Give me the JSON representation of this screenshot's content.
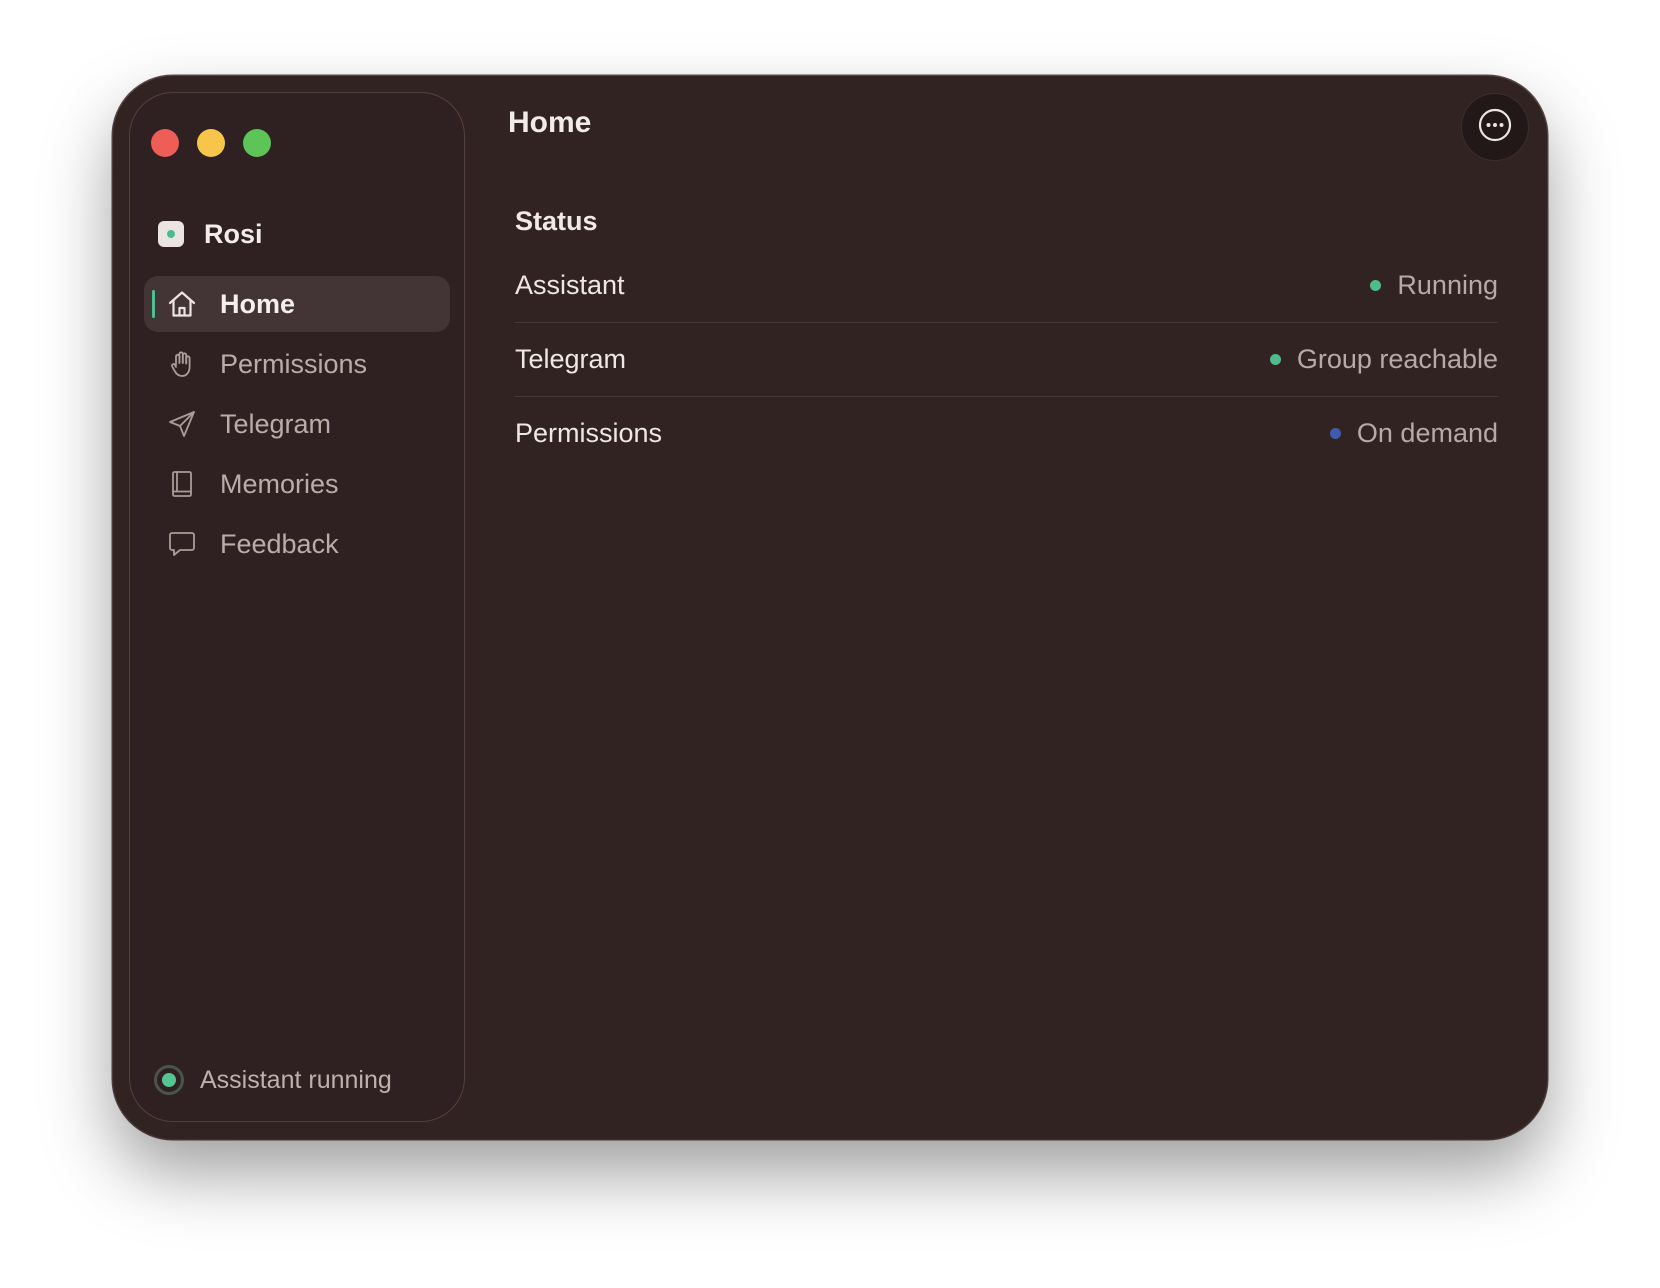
{
  "window": {
    "title": "Home",
    "more_icon": "ellipsis-circle-icon"
  },
  "sidebar": {
    "brand": {
      "name": "Rosi",
      "icon": "app-logo-icon"
    },
    "items": [
      {
        "label": "Home",
        "icon": "house-icon",
        "active": true
      },
      {
        "label": "Permissions",
        "icon": "hand-icon",
        "active": false
      },
      {
        "label": "Telegram",
        "icon": "paper-plane-icon",
        "active": false
      },
      {
        "label": "Memories",
        "icon": "book-icon",
        "active": false
      },
      {
        "label": "Feedback",
        "icon": "chat-bubble-icon",
        "active": false
      }
    ],
    "footer": {
      "text": "Assistant running",
      "indicator_color": "#55c493"
    }
  },
  "main": {
    "section_title": "Status",
    "rows": [
      {
        "label": "Assistant",
        "status": "Running",
        "dot_color": "#4cbc8a"
      },
      {
        "label": "Telegram",
        "status": "Group reachable",
        "dot_color": "#4cbc8a"
      },
      {
        "label": "Permissions",
        "status": "On demand",
        "dot_color": "#3e5bb0"
      }
    ]
  },
  "colors": {
    "window_bg": "#322323",
    "sidebar_bg": "#2f2121",
    "accent": "#4fbf8f",
    "traffic_close": "#ee5d56",
    "traffic_minimize": "#f7c54a",
    "traffic_maximize": "#5dc458"
  }
}
